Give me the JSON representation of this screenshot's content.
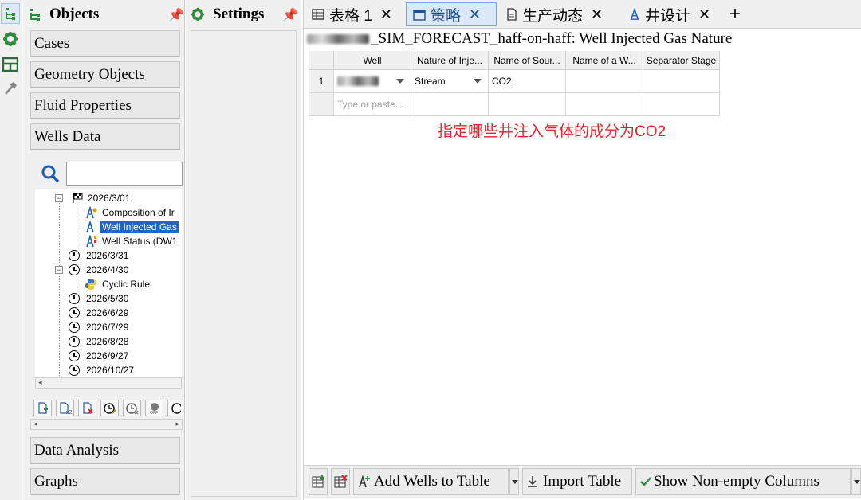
{
  "icon_strip": {
    "items": [
      "tree-icon",
      "gear-icon",
      "layout-icon",
      "hammer-icon"
    ]
  },
  "objects_panel": {
    "title": "Objects",
    "categories_top": [
      "Cases",
      "Geometry Objects",
      "Fluid Properties",
      "Wells Data"
    ],
    "categories_bottom": [
      "Data Analysis",
      "Graphs"
    ],
    "search_value": "",
    "tree": [
      {
        "label": "2026/3/01",
        "icon": "checkered-flag-icon",
        "expandable": true
      },
      {
        "label": "Composition of Ir",
        "icon": "well-rig-icon"
      },
      {
        "label": "Well Injected Gas",
        "icon": "well-rig-icon",
        "selected": true
      },
      {
        "label": "Well Status (DW1",
        "icon": "well-rig-icon"
      },
      {
        "label": "2026/3/31",
        "icon": "clock-icon"
      },
      {
        "label": "2026/4/30",
        "icon": "clock-icon",
        "expandable": true
      },
      {
        "label": "Cyclic Rule",
        "icon": "python-icon"
      },
      {
        "label": "2026/5/30",
        "icon": "clock-icon"
      },
      {
        "label": "2026/6/29",
        "icon": "clock-icon"
      },
      {
        "label": "2026/7/29",
        "icon": "clock-icon"
      },
      {
        "label": "2026/8/28",
        "icon": "clock-icon"
      },
      {
        "label": "2026/9/27",
        "icon": "clock-icon"
      },
      {
        "label": "2026/10/27",
        "icon": "clock-icon"
      }
    ],
    "mini_toolbar": [
      "add-page-icon",
      "copy-page-x2-icon",
      "delete-page-icon",
      "clock-edit-icon",
      "clock-remove-icon",
      "toggle-off-icon"
    ]
  },
  "settings_panel": {
    "title": "Settings"
  },
  "tabs": [
    {
      "label": "表格 1",
      "icon": "table-icon",
      "active": false
    },
    {
      "label": "策略",
      "icon": "calendar-icon",
      "active": true
    },
    {
      "label": "生产动态",
      "icon": "document-icon",
      "active": false
    },
    {
      "label": "井设计",
      "icon": "well-rig-icon",
      "active": false
    }
  ],
  "add_tab_label": "+",
  "doc_title": "_SIM_FORECAST_haff-on-haff: Well Injected Gas Nature",
  "grid": {
    "headers": [
      "Well",
      "Nature of Inje...",
      "Name of Sour...",
      "Name of a W...",
      "Separator Stage"
    ],
    "rows": [
      {
        "num": "1",
        "well": "",
        "nature": "Stream",
        "source": "CO2",
        "name_w": "",
        "separator": ""
      }
    ],
    "new_row_placeholder": "Type or paste..."
  },
  "annotation": "指定哪些井注入气体的成分为CO2",
  "bottom_toolbar": {
    "add_wells_label": "Add Wells to Table",
    "import_label": "Import Table",
    "show_nonempty_label": "Show Non-empty Columns"
  },
  "colors": {
    "accent_blue": "#1e5fb4",
    "annotation_red": "#e8202a",
    "selection_blue": "#1f66c4",
    "icon_green": "#2e8b3c"
  }
}
